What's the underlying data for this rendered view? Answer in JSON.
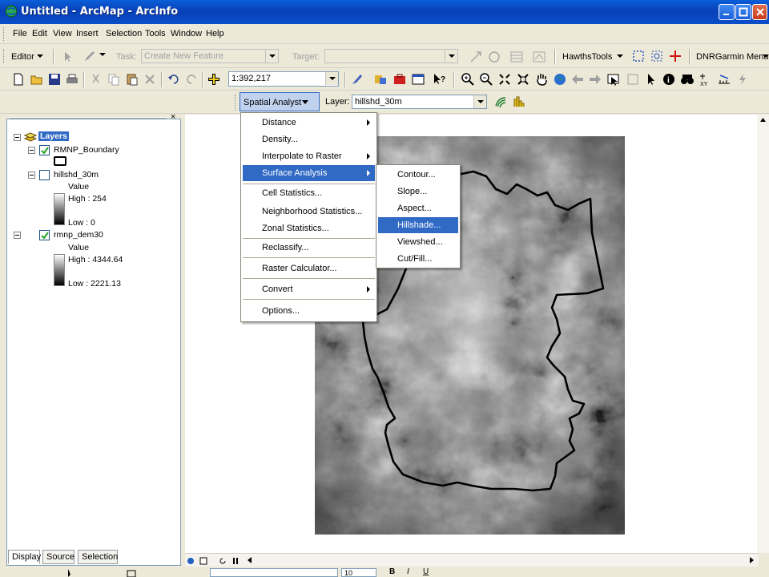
{
  "window": {
    "title": "Untitled - ArcMap - ArcInfo"
  },
  "menubar": {
    "items": [
      "File",
      "Edit",
      "View",
      "Insert",
      "Selection",
      "Tools",
      "Window",
      "Help"
    ]
  },
  "editor_toolbar": {
    "editor_label": "Editor",
    "task_label": "Task:",
    "task_value": "Create New Feature",
    "target_label": "Target:",
    "target_value": "",
    "hawths_label": "HawthsTools",
    "dnr_label": "DNRGarmin Menu"
  },
  "standard_toolbar": {
    "scale_value": "1:392,217"
  },
  "spatial_analyst_toolbar": {
    "menu_label": "Spatial Analyst",
    "layer_label": "Layer:",
    "layer_value": "hillshd_30m"
  },
  "toc": {
    "root_label": "Layers",
    "layers": [
      {
        "name": "RMNP_Boundary",
        "checked": true
      },
      {
        "name": "hillshd_30m",
        "checked": false,
        "value_label": "Value",
        "high": "High : 254",
        "low": "Low : 0"
      },
      {
        "name": "rmnp_dem30",
        "checked": true,
        "value_label": "Value",
        "high": "High : 4344.64",
        "low": "Low : 2221.13"
      }
    ],
    "tabs": [
      "Display",
      "Source",
      "Selection"
    ],
    "active_tab": "Display"
  },
  "spatial_analyst_menu": {
    "items": [
      {
        "label": "Distance",
        "submenu": true
      },
      {
        "label": "Density...",
        "submenu": false
      },
      {
        "label": "Interpolate to Raster",
        "submenu": true
      },
      {
        "label": "Surface Analysis",
        "submenu": true,
        "highlighted": true
      },
      {
        "label": "Cell Statistics...",
        "submenu": false
      },
      {
        "label": "Neighborhood Statistics...",
        "submenu": false
      },
      {
        "label": "Zonal Statistics...",
        "submenu": false
      },
      {
        "label": "Reclassify...",
        "submenu": false
      },
      {
        "label": "Raster Calculator...",
        "submenu": false
      },
      {
        "label": "Convert",
        "submenu": true
      },
      {
        "label": "Options...",
        "submenu": false
      }
    ]
  },
  "surface_analysis_submenu": {
    "items": [
      {
        "label": "Contour..."
      },
      {
        "label": "Slope..."
      },
      {
        "label": "Aspect..."
      },
      {
        "label": "Hillshade...",
        "highlighted": true
      },
      {
        "label": "Viewshed..."
      },
      {
        "label": "Cut/Fill..."
      }
    ]
  },
  "bottom_toolbar": {
    "font_size_value": "10"
  },
  "colors": {
    "titlebar": "#0a4fc8",
    "highlight": "#316ac5",
    "chrome": "#ece9d8"
  }
}
